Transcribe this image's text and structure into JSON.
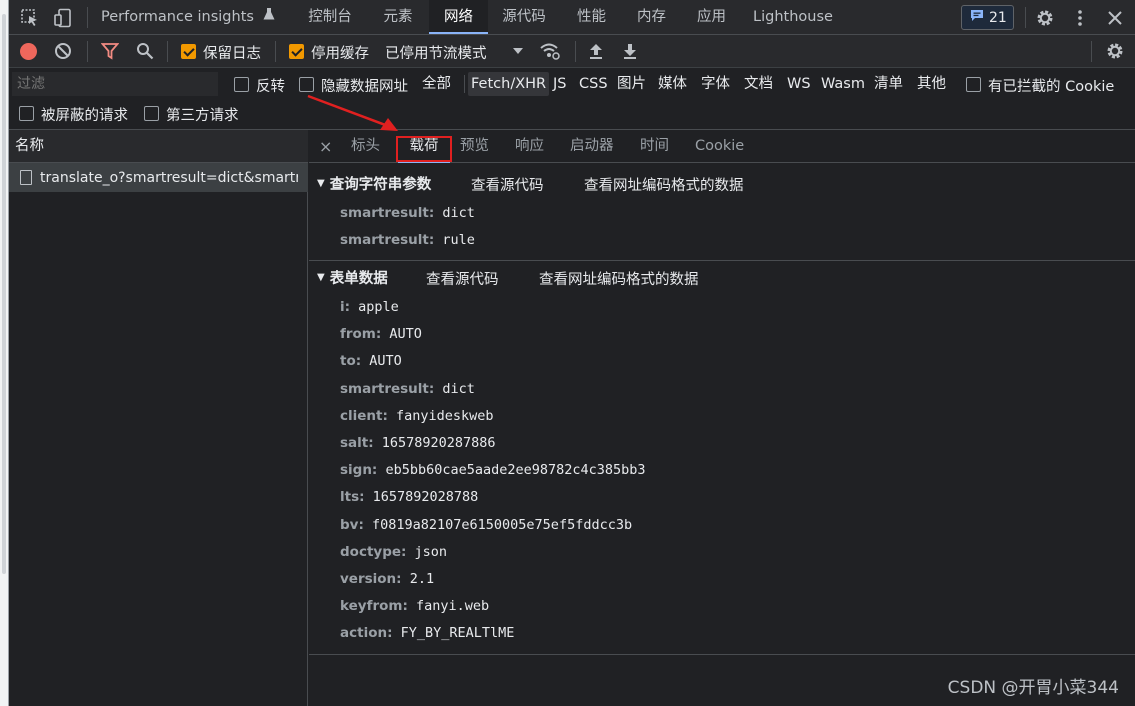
{
  "tabs": [
    "Performance insights",
    "控制台",
    "元素",
    "网络",
    "源代码",
    "性能",
    "内存",
    "应用",
    "Lighthouse"
  ],
  "active_tab": "网络",
  "issues_badge": {
    "count": "21"
  },
  "toolbar": {
    "preserve_log": "保留日志",
    "disable_cache": "停用缓存",
    "throttling": "已停用节流模式"
  },
  "filter": {
    "placeholder": "过滤",
    "invert": "反转",
    "hide_data_urls": "隐藏数据网址",
    "types": [
      "全部",
      "Fetch/XHR",
      "JS",
      "CSS",
      "图片",
      "媒体",
      "字体",
      "文档",
      "WS",
      "Wasm",
      "清单",
      "其他"
    ],
    "active_type": "Fetch/XHR",
    "blocked_cookies": "有已拦截的 Cookie",
    "blocked_requests": "被屏蔽的请求",
    "third_party": "第三方请求"
  },
  "requests": {
    "header": "名称",
    "items": [
      "translate_o?smartresult=dict&smartresult=rule"
    ]
  },
  "details": {
    "close": "×",
    "tabs": [
      "标头",
      "载荷",
      "预览",
      "响应",
      "启动器",
      "时间",
      "Cookie"
    ],
    "active_tab": "载荷",
    "query": {
      "title": "查询字符串参数",
      "view_source": "查看源代码",
      "view_url_encoded": "查看网址编码格式的数据",
      "params": [
        {
          "k": "smartresult",
          "v": "dict"
        },
        {
          "k": "smartresult",
          "v": "rule"
        }
      ]
    },
    "form": {
      "title": "表单数据",
      "view_source": "查看源代码",
      "view_url_encoded": "查看网址编码格式的数据",
      "params": [
        {
          "k": "i",
          "v": "apple"
        },
        {
          "k": "from",
          "v": "AUTO"
        },
        {
          "k": "to",
          "v": "AUTO"
        },
        {
          "k": "smartresult",
          "v": "dict"
        },
        {
          "k": "client",
          "v": "fanyideskweb"
        },
        {
          "k": "salt",
          "v": "16578920287886"
        },
        {
          "k": "sign",
          "v": "eb5bb60cae5aade2ee98782c4c385bb3"
        },
        {
          "k": "lts",
          "v": "1657892028788"
        },
        {
          "k": "bv",
          "v": "f0819a82107e6150005e75ef5fddcc3b"
        },
        {
          "k": "doctype",
          "v": "json"
        },
        {
          "k": "version",
          "v": "2.1"
        },
        {
          "k": "keyfrom",
          "v": "fanyi.web"
        },
        {
          "k": "action",
          "v": "FY_BY_REALTlME"
        }
      ]
    }
  },
  "watermark": "CSDN @开胃小菜344",
  "colors": {
    "accent": "#8ab4f8",
    "record": "#ee675c",
    "checkbox": "#f29900",
    "annotation": "#e02020"
  }
}
